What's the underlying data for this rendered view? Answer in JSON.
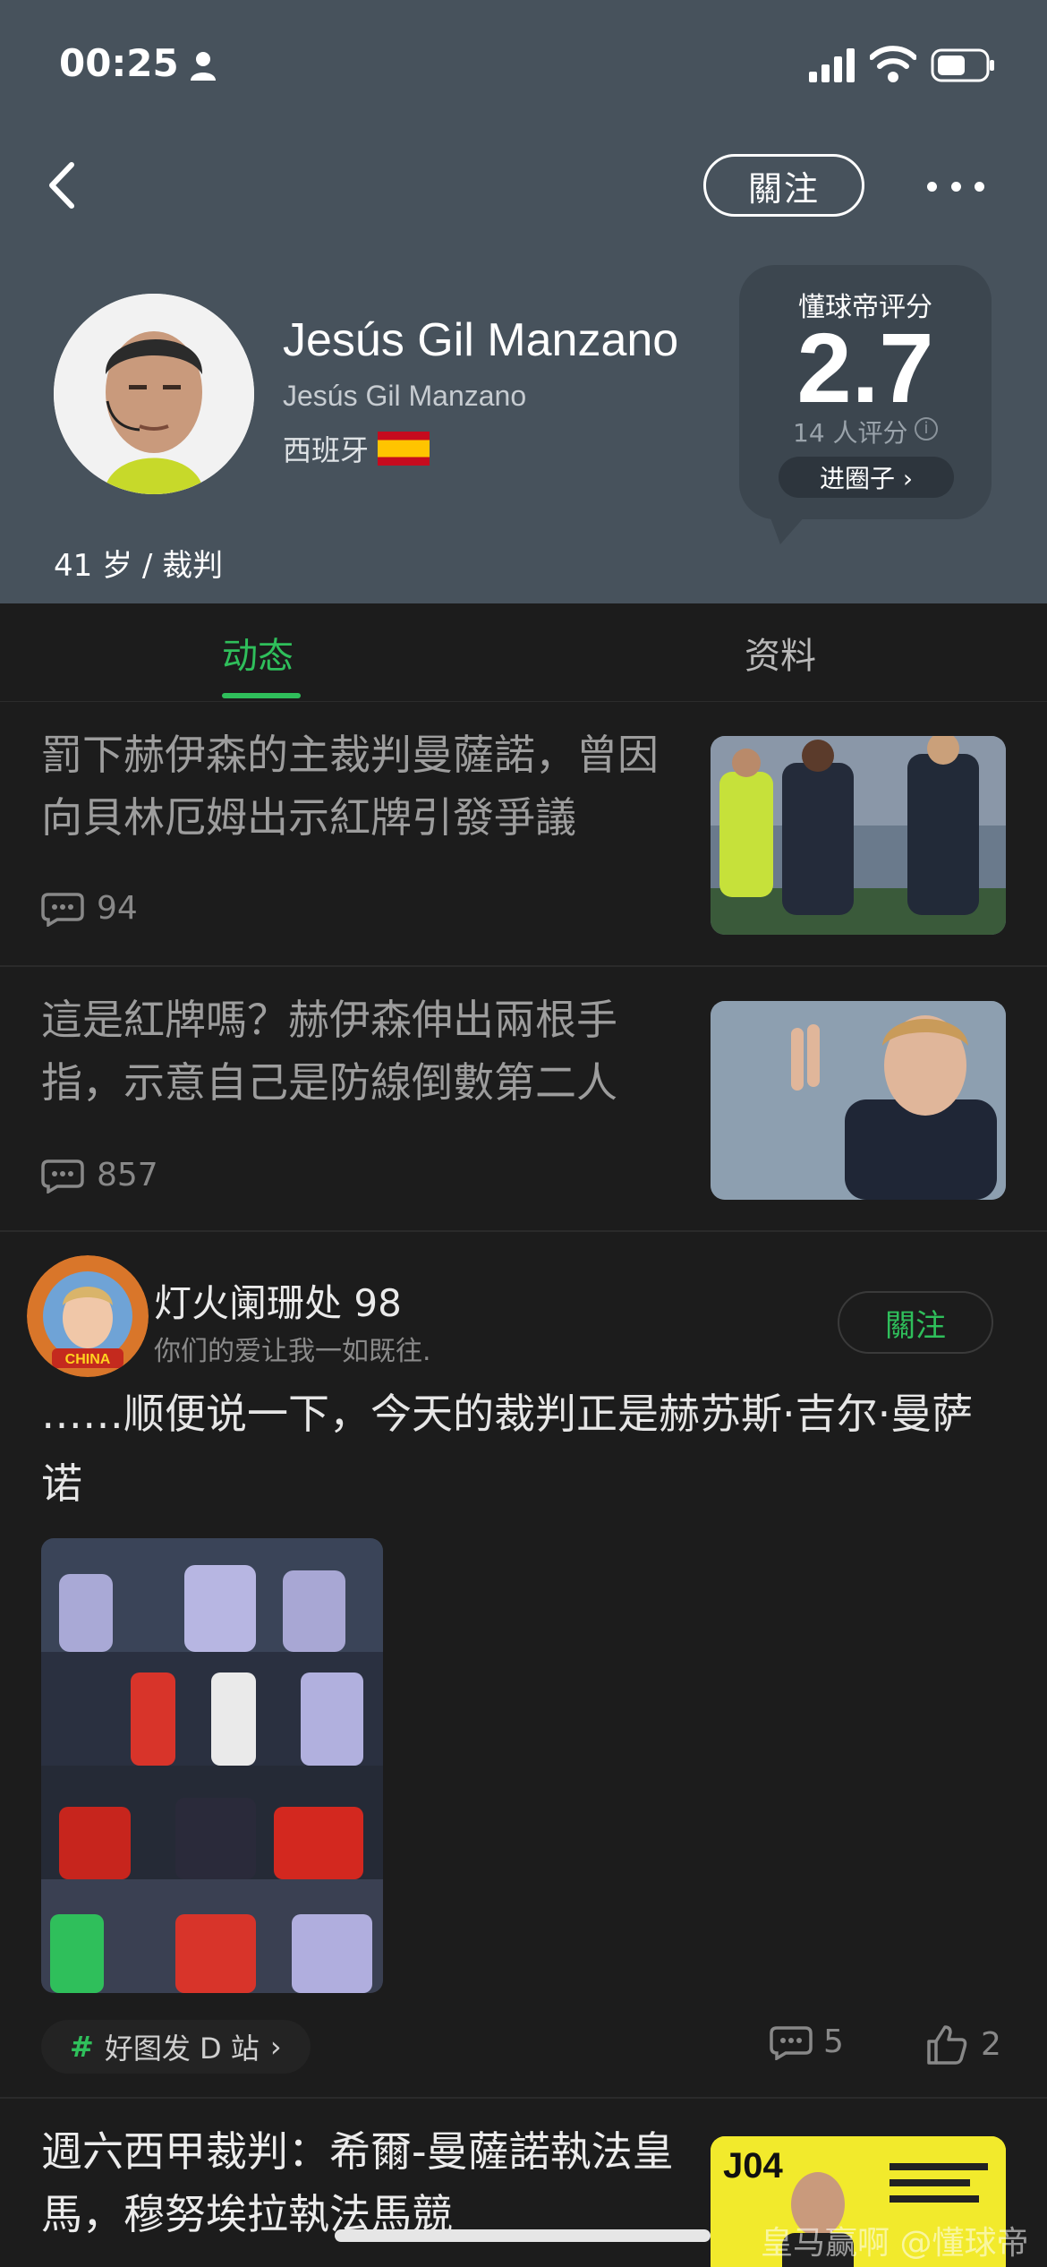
{
  "status_bar": {
    "time": "00:25"
  },
  "header": {
    "follow_label": "關注",
    "name": "Jesús Gil Manzano",
    "alt_name": "Jesús Gil Manzano",
    "country": "西班牙",
    "age_role": "41 岁 / 裁判",
    "rating": {
      "label": "懂球帝评分",
      "value": "2.7",
      "count": "14 人评分",
      "circle_button": "进圈子 ›"
    }
  },
  "tabs": [
    {
      "label": "动态",
      "active": true
    },
    {
      "label": "资料",
      "active": false
    }
  ],
  "news": [
    {
      "title": "罰下赫伊森的主裁判曼薩諾，曾因向貝林厄姆出示紅牌引發爭議",
      "comments": "94"
    },
    {
      "title": "這是紅牌嗎？赫伊森伸出兩根手指，示意自己是防線倒數第二人",
      "comments": "857"
    }
  ],
  "post": {
    "username": "灯火阑珊处 98",
    "signature": "你们的爱让我一如既往.",
    "follow_label": "關注",
    "text": "……顺便说一下，今天的裁判正是赫苏斯·吉尔·曼萨诺",
    "tag": "好图发 D 站",
    "comments": "5",
    "likes": "2"
  },
  "news_last": {
    "title": "週六西甲裁判：希爾-曼薩諾執法皇馬，穆努埃拉執法馬競"
  },
  "watermark": "皇马赢啊 @懂球帝",
  "colors": {
    "accent": "#2fbf5b",
    "header_bg": "#47525c",
    "body_bg": "#1c1c1c"
  }
}
